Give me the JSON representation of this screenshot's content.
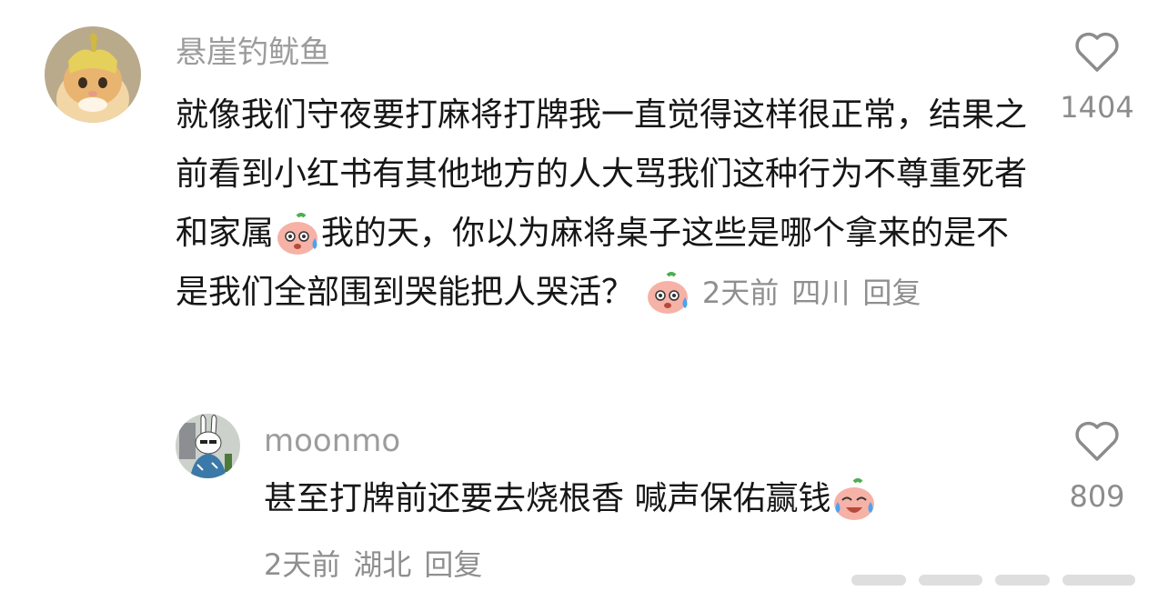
{
  "comments": [
    {
      "username": "悬崖钓鱿鱼",
      "avatar_icon": "cat-with-banana-peel-avatar",
      "text_parts": [
        "就像我们守夜要打麻将打牌我一直觉得这样很正常，结果之前看到小红书有其他地方的人大骂我们这种行为不尊重死者和家属",
        "我的天，你以为麻将桌子这些是哪个拿来的是不是我们全部围到哭能把人哭活？"
      ],
      "emoji": "sweat-peach-emoji",
      "time": "2天前",
      "location": "四川",
      "reply_label": "回复",
      "likes": "1404"
    },
    {
      "username": "moonmo",
      "avatar_icon": "rabbit-cartoon-avatar",
      "text": "甚至打牌前还要去烧根香 喊声保佑赢钱",
      "emoji": "crying-laughing-peach-emoji",
      "time": "2天前",
      "location": "湖北",
      "reply_label": "回复",
      "likes": "809"
    }
  ],
  "colors": {
    "meta": "#8f8f8f",
    "username": "#9c9c9c",
    "text": "#161616",
    "background": "#ffffff"
  }
}
